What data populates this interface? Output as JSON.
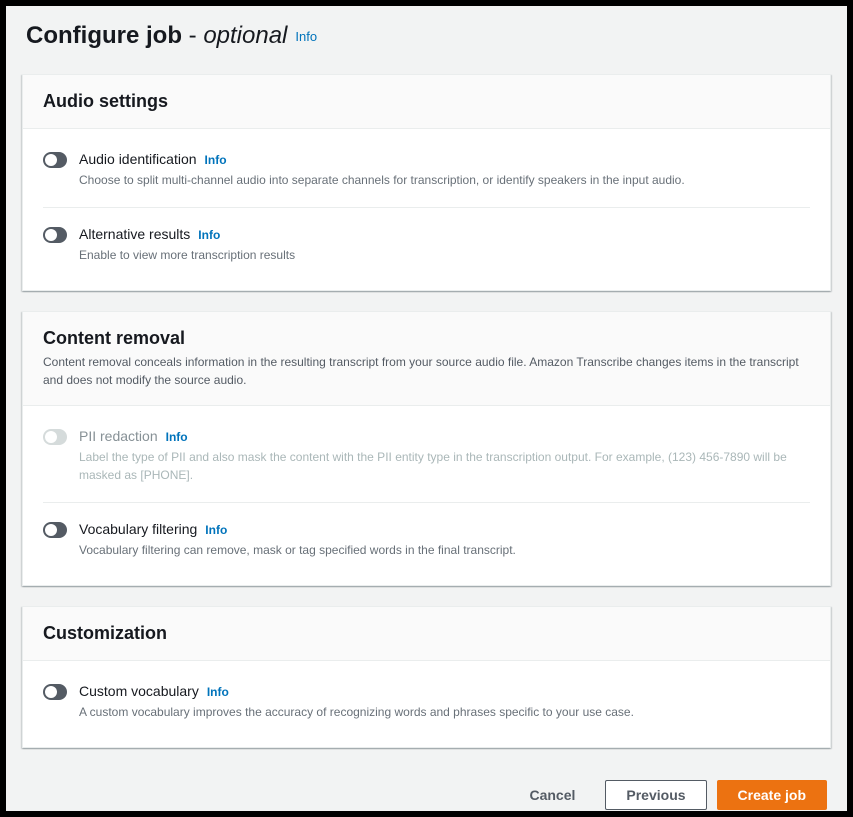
{
  "header": {
    "title_main": "Configure job",
    "title_separator": " - ",
    "title_optional": "optional",
    "info": "Info"
  },
  "panels": {
    "audio": {
      "title": "Audio settings",
      "items": [
        {
          "label": "Audio identification",
          "info": "Info",
          "desc": "Choose to split multi-channel audio into separate channels for transcription, or identify speakers in the input audio."
        },
        {
          "label": "Alternative results",
          "info": "Info",
          "desc": "Enable to view more transcription results"
        }
      ]
    },
    "content_removal": {
      "title": "Content removal",
      "subtitle": "Content removal conceals information in the resulting transcript from your source audio file. Amazon Transcribe changes items in the transcript and does not modify the source audio.",
      "items": [
        {
          "label": "PII redaction",
          "info": "Info",
          "desc": "Label the type of PII and also mask the content with the PII entity type in the transcription output. For example, (123) 456-7890 will be masked as [PHONE]."
        },
        {
          "label": "Vocabulary filtering",
          "info": "Info",
          "desc": "Vocabulary filtering can remove, mask or tag specified words in the final transcript."
        }
      ]
    },
    "customization": {
      "title": "Customization",
      "items": [
        {
          "label": "Custom vocabulary",
          "info": "Info",
          "desc": "A custom vocabulary improves the accuracy of recognizing words and phrases specific to your use case."
        }
      ]
    }
  },
  "footer": {
    "cancel": "Cancel",
    "previous": "Previous",
    "create": "Create job"
  }
}
